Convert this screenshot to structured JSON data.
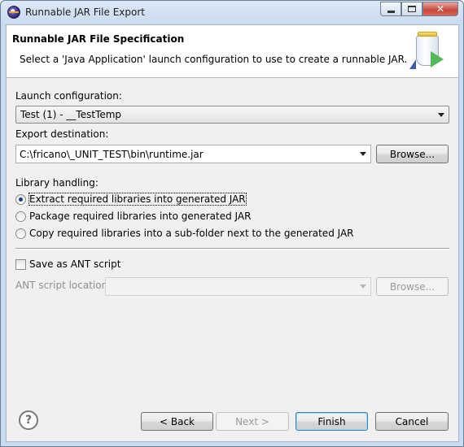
{
  "window": {
    "title": "Runnable JAR File Export",
    "controls": {
      "minimize": "min",
      "maximize": "max",
      "close": "✕"
    }
  },
  "header": {
    "title": "Runnable JAR File Specification",
    "description": "Select a 'Java Application' launch configuration to use to create a runnable JAR.",
    "art_icon": "jar-export-icon"
  },
  "launch": {
    "label": "Launch configuration:",
    "selected": "Test (1) - __TestTemp"
  },
  "export": {
    "label": "Export destination:",
    "value": "C:\\fricano\\_UNIT_TEST\\bin\\runtime.jar",
    "browse_label": "Browse..."
  },
  "library": {
    "label": "Library handling:",
    "options": [
      "Extract required libraries into generated JAR",
      "Package required libraries into generated JAR",
      "Copy required libraries into a sub-folder next to the generated JAR"
    ],
    "selected_index": 0
  },
  "ant": {
    "checkbox_label": "Save as ANT script",
    "checked": false,
    "location_label": "ANT script location:",
    "location_value": "",
    "browse_label": "Browse..."
  },
  "footer": {
    "help_icon": "?",
    "back_label": "< Back",
    "next_label": "Next >",
    "finish_label": "Finish",
    "cancel_label": "Cancel"
  },
  "colors": {
    "title_bar": "#c9dbef",
    "dialog_bg": "#f0f0f0",
    "default_button_border": "#3c7fb1",
    "close_button": "#c8473a"
  }
}
